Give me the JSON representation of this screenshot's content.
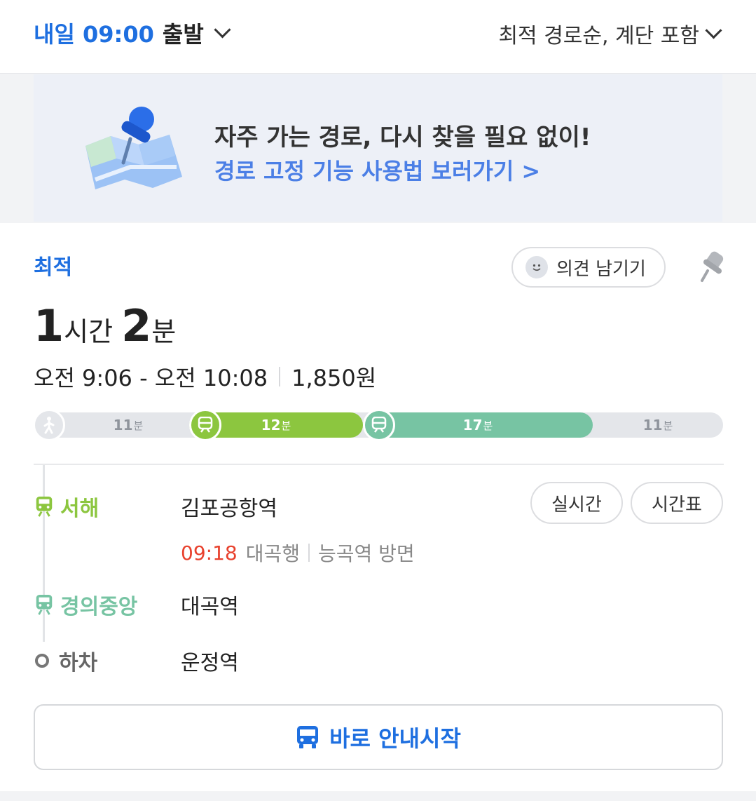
{
  "header": {
    "departure_when": "내일 09:00",
    "departure_action": "출발",
    "sort_option": "최적 경로순, 계단 포함"
  },
  "banner": {
    "title": "자주 가는 경로, 다시 찾을 필요 없이!",
    "link": "경로 고정 기능 사용법 보러가기 >"
  },
  "route": {
    "badge": "최적",
    "feedback_label": "의견 남기기",
    "duration": {
      "hours": "1",
      "hours_unit": "시간",
      "minutes": "2",
      "minutes_unit": "분"
    },
    "time_range": "오전 9:06 - 오전 10:08",
    "fare": "1,850원",
    "segments": [
      {
        "kind": "walk",
        "minutes": "11",
        "unit": "분",
        "color": "#e4e6ea"
      },
      {
        "kind": "subway",
        "minutes": "12",
        "unit": "분",
        "color": "#8cc63f"
      },
      {
        "kind": "subway",
        "minutes": "17",
        "unit": "분",
        "color": "#77c4a3"
      },
      {
        "kind": "walk",
        "minutes": "11",
        "unit": "분",
        "color": "#e4e6ea"
      }
    ],
    "legs": [
      {
        "line": "서해",
        "station": "김포공항역",
        "color": "#8cc63f"
      },
      {
        "line": "경의중앙",
        "station": "대곡역",
        "color": "#77c4a3"
      },
      {
        "line": "하차",
        "station": "운정역",
        "color": "#666666"
      }
    ],
    "departure_info": {
      "time": "09:18",
      "bound": "대곡행",
      "direction": "능곡역 방면"
    },
    "realtime_button": "실시간",
    "timetable_button": "시간표",
    "start_button": "바로 안내시작"
  }
}
